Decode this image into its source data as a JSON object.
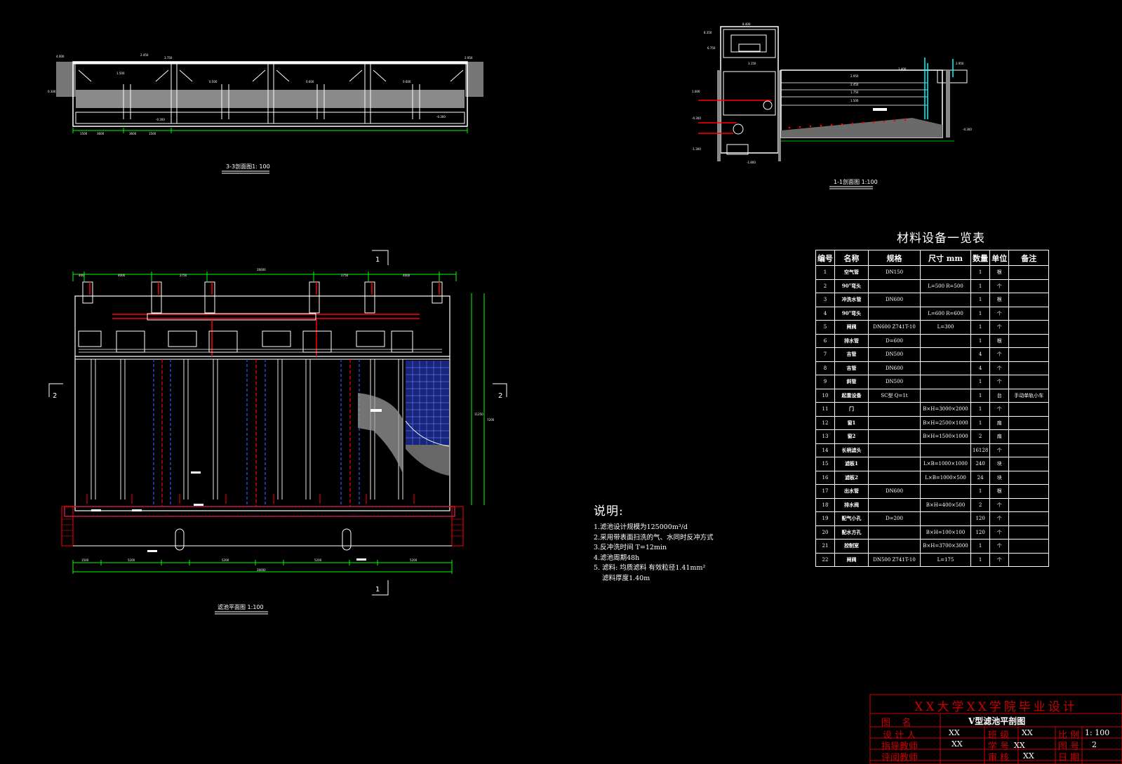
{
  "drawings": {
    "section_3_3": {
      "title": "3-3剖面图1: 100"
    },
    "section_1_1": {
      "title": "1-1剖面图 1:100"
    },
    "plan": {
      "title": "滤池平面图 1:100",
      "cut_marks": [
        "1",
        "1",
        "2",
        "2"
      ]
    }
  },
  "materials_table": {
    "title": "材料设备一览表",
    "headers": [
      "编号",
      "名称",
      "规格",
      "尺寸  mm",
      "数量",
      "单位",
      "备注"
    ],
    "rows": [
      [
        "1",
        "空气管",
        "DN150",
        "",
        "1",
        "根",
        ""
      ],
      [
        "2",
        "90°弯头",
        "",
        "L=500 R=500",
        "1",
        "个",
        ""
      ],
      [
        "3",
        "冲洗水管",
        "DN600",
        "",
        "1",
        "根",
        ""
      ],
      [
        "4",
        "90°弯头",
        "",
        "L=600 R=600",
        "1",
        "个",
        ""
      ],
      [
        "5",
        "闸阀",
        "DN600 Z741T-10",
        "L=300",
        "1",
        "个",
        ""
      ],
      [
        "6",
        "排水管",
        "D=600",
        "",
        "1",
        "根",
        ""
      ],
      [
        "7",
        "吉管",
        "DN500",
        "",
        "4",
        "个",
        ""
      ],
      [
        "8",
        "吉管",
        "DN600",
        "",
        "4",
        "个",
        ""
      ],
      [
        "9",
        "斜管",
        "DN500",
        "",
        "1",
        "个",
        ""
      ],
      [
        "10",
        "起重设备",
        "SC型 Q=1t",
        "",
        "1",
        "台",
        "手动单轨小车"
      ],
      [
        "11",
        "门",
        "",
        "B×H=3000×2000",
        "1",
        "个",
        ""
      ],
      [
        "12",
        "窗1",
        "",
        "B×H=2500×1000",
        "1",
        "扇",
        ""
      ],
      [
        "13",
        "窗2",
        "",
        "B×H=1500×1000",
        "2",
        "扇",
        ""
      ],
      [
        "14",
        "长柄滤头",
        "",
        "",
        "16128",
        "个",
        ""
      ],
      [
        "15",
        "滤板1",
        "",
        "L×B=1000×1000",
        "240",
        "块",
        ""
      ],
      [
        "16",
        "滤板2",
        "",
        "L×B=1000×500",
        "24",
        "块",
        ""
      ],
      [
        "17",
        "出水管",
        "DN600",
        "",
        "1",
        "根",
        ""
      ],
      [
        "18",
        "排水阀",
        "",
        "B×H=400×500",
        "2",
        "个",
        ""
      ],
      [
        "19",
        "配气小孔",
        "D=200",
        "",
        "120",
        "个",
        ""
      ],
      [
        "20",
        "配水方孔",
        "",
        "B×H=100×100",
        "120",
        "个",
        ""
      ],
      [
        "21",
        "控制室",
        "",
        "B×H=3700×3000",
        "1",
        "个",
        ""
      ],
      [
        "22",
        "闸阀",
        "DN500 Z741T-10",
        "L=175",
        "1",
        "个",
        ""
      ]
    ]
  },
  "notes": {
    "heading": "说明:",
    "lines": [
      "1.滤池设计规模为125000m³/d",
      "2.采用带表面扫洗的气、水同时反冲方式",
      "3.反冲洗时间 T=12min",
      "4.滤池周期48h",
      "5. 滤料: 均质滤料  有效粒径1.41mm²",
      "    滤料厚度1.40m"
    ]
  },
  "title_block": {
    "school": "XX大学XX学院毕业设计",
    "drawing_name_label": "图    名",
    "drawing_name": "V型滤池平剖图",
    "designer_label": "设 计 人",
    "designer": "XX",
    "class_label": "班 级",
    "class_value": "XX",
    "scale_label": "比 例",
    "scale": "1: 100",
    "advisor_label": "指导教师",
    "advisor": "XX",
    "student_id_label": "学 号",
    "student_id": "XX",
    "sheet_label": "图 号",
    "sheet": "2",
    "reviewer_label": "评阅教师",
    "audit_label": "审 核",
    "audit": "XX",
    "date_label": "日 期"
  },
  "colors": {
    "line": "#ffffff",
    "dim": "#00ff00",
    "red": "#ff0000",
    "blue": "#3355ff",
    "cyan": "#00ffff",
    "title_block": "#d00000"
  }
}
